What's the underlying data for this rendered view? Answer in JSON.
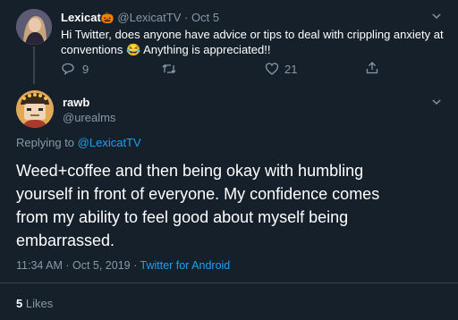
{
  "parent_tweet": {
    "display_name": "Lexicat",
    "display_emoji": "🎃",
    "handle": "@LexicatTV",
    "separator": "·",
    "date": "Oct 5",
    "text_line1": "Hi Twitter, does anyone have advice or tips to deal with crippling anxiety at",
    "text_line2a": "conventions",
    "text_emoji": "😂",
    "text_line2b": "Anything is appreciated!!",
    "reply_count": "9",
    "like_count": "21"
  },
  "main_tweet": {
    "display_name": "rawb",
    "handle": "@urealms",
    "replying_prefix": "Replying to",
    "replying_handle": "@LexicatTV",
    "line1": "Weed+coffee and then being okay with humbling",
    "line2": "yourself in front of everyone. My confidence comes",
    "line3": "from my ability to feel good about myself being",
    "line4": "embarrassed.",
    "timestamp": "11:34 AM · Oct 5, 2019 ·",
    "source": "Twitter for Android",
    "likes_count": "5",
    "likes_label": "Likes"
  },
  "colors": {
    "background": "#15202b",
    "muted": "#8899a6",
    "accent": "#1da1f2",
    "divider": "#38444d"
  },
  "icons": [
    "chevron-down-icon",
    "reply-icon",
    "retweet-icon",
    "like-icon",
    "share-icon"
  ]
}
